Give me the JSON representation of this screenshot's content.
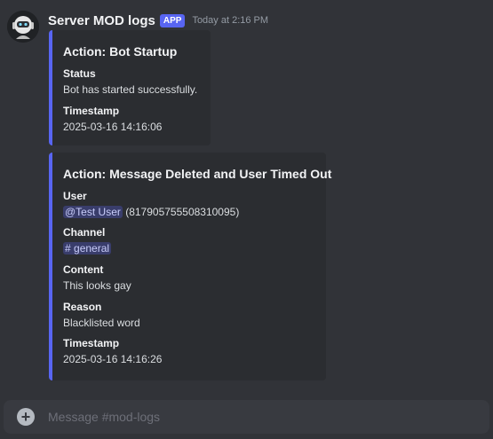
{
  "message": {
    "username": "Server MOD logs",
    "badge": "APP",
    "timestamp": "Today at 2:16 PM"
  },
  "embeds": [
    {
      "title": "Action: Bot Startup",
      "fields": [
        {
          "name": "Status",
          "value": "Bot has started successfully."
        },
        {
          "name": "Timestamp",
          "value": "2025-03-16 14:16:06"
        }
      ]
    },
    {
      "title": "Action: Message Deleted and User Timed Out",
      "user_field": {
        "name": "User",
        "mention": "@Test User",
        "id_text": "(817905755508310095)"
      },
      "channel_field": {
        "name": "Channel",
        "hash": "#",
        "channel": "general"
      },
      "fields": [
        {
          "name": "Content",
          "value": "This looks gay"
        },
        {
          "name": "Reason",
          "value": "Blacklisted word"
        },
        {
          "name": "Timestamp",
          "value": "2025-03-16 14:16:26"
        }
      ]
    }
  ],
  "composer": {
    "placeholder": "Message #mod-logs",
    "icon": "plus-circle-icon"
  },
  "colors": {
    "background": "#313338",
    "embed_bg": "#2b2d31",
    "accent": "#5865f2"
  }
}
